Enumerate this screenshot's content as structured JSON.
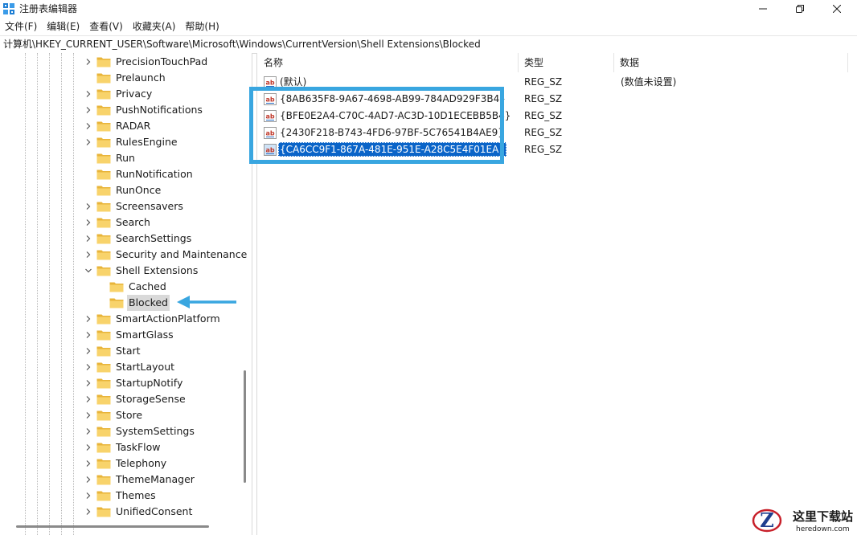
{
  "window": {
    "title": "注册表编辑器",
    "icon": "regedit-icon",
    "controls": [
      "minimize-icon",
      "maximize-icon",
      "close-icon"
    ]
  },
  "menu": [
    "文件(F)",
    "编辑(E)",
    "查看(V)",
    "收藏夹(A)",
    "帮助(H)"
  ],
  "address": "计算机\\HKEY_CURRENT_USER\\Software\\Microsoft\\Windows\\CurrentVersion\\Shell Extensions\\Blocked",
  "tree": {
    "items": [
      {
        "label": "PrecisionTouchPad",
        "expander": "collapsed"
      },
      {
        "label": "Prelaunch",
        "expander": "none"
      },
      {
        "label": "Privacy",
        "expander": "collapsed"
      },
      {
        "label": "PushNotifications",
        "expander": "collapsed"
      },
      {
        "label": "RADAR",
        "expander": "collapsed"
      },
      {
        "label": "RulesEngine",
        "expander": "collapsed"
      },
      {
        "label": "Run",
        "expander": "none"
      },
      {
        "label": "RunNotification",
        "expander": "none"
      },
      {
        "label": "RunOnce",
        "expander": "none"
      },
      {
        "label": "Screensavers",
        "expander": "collapsed"
      },
      {
        "label": "Search",
        "expander": "collapsed"
      },
      {
        "label": "SearchSettings",
        "expander": "collapsed"
      },
      {
        "label": "Security and Maintenance",
        "expander": "collapsed"
      },
      {
        "label": "Shell Extensions",
        "expander": "expanded"
      },
      {
        "label": "Cached",
        "expander": "none",
        "child": true
      },
      {
        "label": "Blocked",
        "expander": "none",
        "child": true,
        "selected": true
      },
      {
        "label": "SmartActionPlatform",
        "expander": "collapsed"
      },
      {
        "label": "SmartGlass",
        "expander": "collapsed"
      },
      {
        "label": "Start",
        "expander": "collapsed"
      },
      {
        "label": "StartLayout",
        "expander": "collapsed"
      },
      {
        "label": "StartupNotify",
        "expander": "collapsed"
      },
      {
        "label": "StorageSense",
        "expander": "collapsed"
      },
      {
        "label": "Store",
        "expander": "collapsed"
      },
      {
        "label": "SystemSettings",
        "expander": "collapsed"
      },
      {
        "label": "TaskFlow",
        "expander": "collapsed"
      },
      {
        "label": "Telephony",
        "expander": "collapsed"
      },
      {
        "label": "ThemeManager",
        "expander": "collapsed"
      },
      {
        "label": "Themes",
        "expander": "collapsed"
      },
      {
        "label": "UnifiedConsent",
        "expander": "collapsed"
      }
    ]
  },
  "list": {
    "columns": {
      "name": "名称",
      "type": "类型",
      "data": "数据"
    },
    "rows": [
      {
        "name": "(默认)",
        "type": "REG_SZ",
        "data": "(数值未设置)"
      },
      {
        "name": "{8AB635F8-9A67-4698-AB99-784AD929F3B4}",
        "type": "REG_SZ",
        "data": ""
      },
      {
        "name": "{BFE0E2A4-C70C-4AD7-AC3D-10D1ECEBB5B4}",
        "type": "REG_SZ",
        "data": ""
      },
      {
        "name": "{2430F218-B743-4FD6-97BF-5C76541B4AE9}",
        "type": "REG_SZ",
        "data": ""
      },
      {
        "name": "{CA6CC9F1-867A-481E-951E-A28C5E4F01EA}",
        "type": "REG_SZ",
        "data": "",
        "selected": true
      }
    ]
  },
  "annotation": {
    "highlight_color": "#39a6e0"
  },
  "watermark": {
    "name": "这里下载站",
    "url": "heredown.com"
  }
}
